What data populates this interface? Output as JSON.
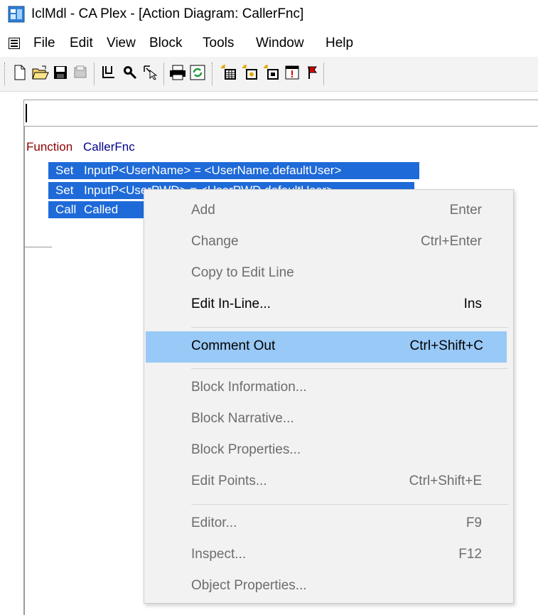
{
  "window": {
    "title": "IclMdl - CA Plex - [Action Diagram: CallerFnc]"
  },
  "menubar": {
    "items": [
      "File",
      "Edit",
      "View",
      "Block",
      "Tools",
      "Window",
      "Help"
    ]
  },
  "toolbar": {
    "icons": [
      "new-file-icon",
      "open-folder-icon",
      "save-icon",
      "print-preview-icon",
      "find-icon",
      "inspect-icon",
      "pointer-icon",
      "print-icon",
      "refresh-icon",
      "grid-icon-1",
      "grid-icon-2",
      "grid-icon-3",
      "warning-icon",
      "flag-icon"
    ]
  },
  "edit_line": {
    "value": ""
  },
  "diagram": {
    "function_keyword": "Function",
    "function_name": "CallerFnc",
    "rows": [
      {
        "keyword": "Set",
        "text": "InputP<UserName> = <UserName.defaultUser>"
      },
      {
        "keyword": "Set",
        "text": "InputP<UserPWD> = <UserPWD.defaultUser>"
      },
      {
        "keyword": "Call",
        "text": "Called"
      }
    ]
  },
  "context_menu": {
    "items": [
      {
        "label": "Add",
        "shortcut": "Enter",
        "enabled": false
      },
      {
        "label": "Change",
        "shortcut": "Ctrl+Enter",
        "enabled": false
      },
      {
        "label": "Copy to Edit Line",
        "shortcut": "",
        "enabled": false
      },
      {
        "label": "Edit In-Line...",
        "shortcut": "Ins",
        "enabled": true
      },
      {
        "label": "Comment Out",
        "shortcut": "Ctrl+Shift+C",
        "enabled": true,
        "highlighted": true
      },
      {
        "label": "Block Information...",
        "shortcut": "",
        "enabled": false
      },
      {
        "label": "Block Narrative...",
        "shortcut": "",
        "enabled": false
      },
      {
        "label": "Block Properties...",
        "shortcut": "",
        "enabled": false
      },
      {
        "label": "Edit Points...",
        "shortcut": "Ctrl+Shift+E",
        "enabled": false
      },
      {
        "label": "Editor...",
        "shortcut": "F9",
        "enabled": false
      },
      {
        "label": "Inspect...",
        "shortcut": "F12",
        "enabled": false
      },
      {
        "label": "Object Properties...",
        "shortcut": "",
        "enabled": false
      }
    ]
  },
  "colors": {
    "selection": "#1e6ad8",
    "menu_highlight": "#99c9f6",
    "function_keyword": "#8b0000",
    "function_name": "#00008b"
  }
}
